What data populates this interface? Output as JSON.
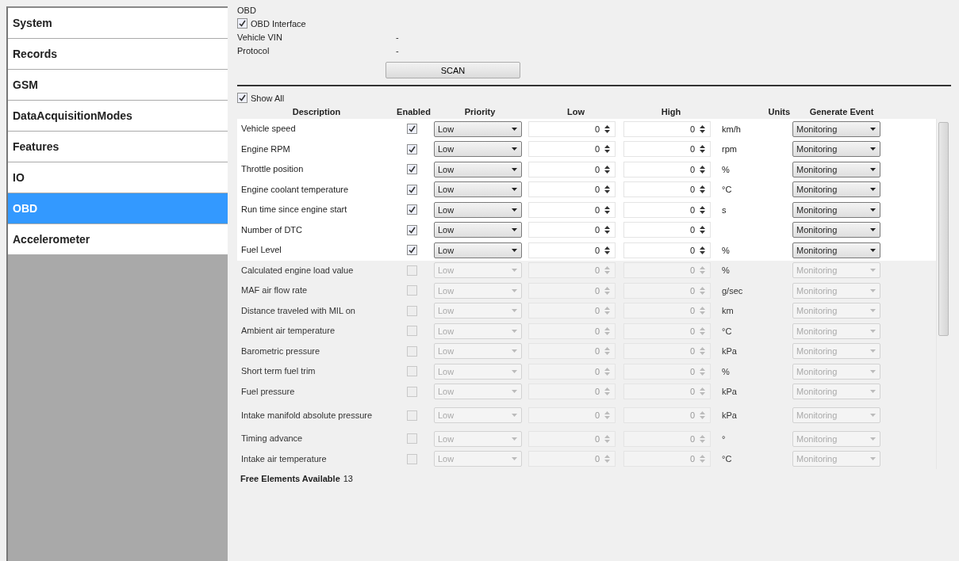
{
  "sidebar": {
    "items": [
      {
        "label": "System",
        "selected": false
      },
      {
        "label": "Records",
        "selected": false
      },
      {
        "label": "GSM",
        "selected": false
      },
      {
        "label": "DataAcquisitionModes",
        "selected": false
      },
      {
        "label": "Features",
        "selected": false
      },
      {
        "label": "IO",
        "selected": false
      },
      {
        "label": "OBD",
        "selected": true
      },
      {
        "label": "Accelerometer",
        "selected": false
      }
    ]
  },
  "obd": {
    "title": "OBD",
    "interface": {
      "label": "OBD Interface",
      "checked": true
    },
    "fields": [
      {
        "label": "Vehicle VIN",
        "value": "-"
      },
      {
        "label": "Protocol",
        "value": "-"
      }
    ],
    "scan_button": "SCAN"
  },
  "show_all": {
    "label": "Show All",
    "checked": true
  },
  "table": {
    "columns": [
      "Description",
      "Enabled",
      "Priority",
      "Low",
      "High",
      "Units",
      "Generate Event"
    ],
    "rows": [
      {
        "description": "Vehicle speed",
        "enabled": true,
        "priority": "Low",
        "low": "0",
        "high": "0",
        "units": "km/h",
        "event": "Monitoring"
      },
      {
        "description": "Engine RPM",
        "enabled": true,
        "priority": "Low",
        "low": "0",
        "high": "0",
        "units": "rpm",
        "event": "Monitoring"
      },
      {
        "description": "Throttle position",
        "enabled": true,
        "priority": "Low",
        "low": "0",
        "high": "0",
        "units": "%",
        "event": "Monitoring"
      },
      {
        "description": "Engine coolant temperature",
        "enabled": true,
        "priority": "Low",
        "low": "0",
        "high": "0",
        "units": "°C",
        "event": "Monitoring"
      },
      {
        "description": "Run time since engine start",
        "enabled": true,
        "priority": "Low",
        "low": "0",
        "high": "0",
        "units": "s",
        "event": "Monitoring"
      },
      {
        "description": "Number of DTC",
        "enabled": true,
        "priority": "Low",
        "low": "0",
        "high": "0",
        "event": "Monitoring"
      },
      {
        "description": "Fuel Level",
        "enabled": true,
        "priority": "Low",
        "low": "0",
        "high": "0",
        "units": "%",
        "event": "Monitoring"
      },
      {
        "description": "Calculated engine load value",
        "enabled": false,
        "priority": "Low",
        "low": "0",
        "high": "0",
        "units": "%",
        "event": "Monitoring"
      },
      {
        "description": "MAF air flow rate",
        "enabled": false,
        "priority": "Low",
        "low": "0",
        "high": "0",
        "units": "g/sec",
        "event": "Monitoring"
      },
      {
        "description": "Distance traveled with MIL on",
        "enabled": false,
        "priority": "Low",
        "low": "0",
        "high": "0",
        "units": "km",
        "event": "Monitoring"
      },
      {
        "description": "Ambient air temperature",
        "enabled": false,
        "priority": "Low",
        "low": "0",
        "high": "0",
        "units": "°C",
        "event": "Monitoring"
      },
      {
        "description": "Barometric pressure",
        "enabled": false,
        "priority": "Low",
        "low": "0",
        "high": "0",
        "units": "kPa",
        "event": "Monitoring"
      },
      {
        "description": "Short term fuel trim",
        "enabled": false,
        "priority": "Low",
        "low": "0",
        "high": "0",
        "units": "%",
        "event": "Monitoring"
      },
      {
        "description": "Fuel pressure",
        "enabled": false,
        "priority": "Low",
        "low": "0",
        "high": "0",
        "units": "kPa",
        "event": "Monitoring"
      },
      {
        "description": "Intake manifold absolute pressure",
        "enabled": false,
        "priority": "Low",
        "low": "0",
        "high": "0",
        "units": "kPa",
        "event": "Monitoring"
      },
      {
        "description": "Timing advance",
        "enabled": false,
        "priority": "Low",
        "low": "0",
        "high": "0",
        "units": "°",
        "event": "Monitoring"
      },
      {
        "description": "Intake air temperature",
        "enabled": false,
        "priority": "Low",
        "low": "0",
        "high": "0",
        "units": "°C",
        "event": "Monitoring"
      }
    ]
  },
  "free_elements": {
    "label": "Free Elements Available",
    "value": "13"
  }
}
